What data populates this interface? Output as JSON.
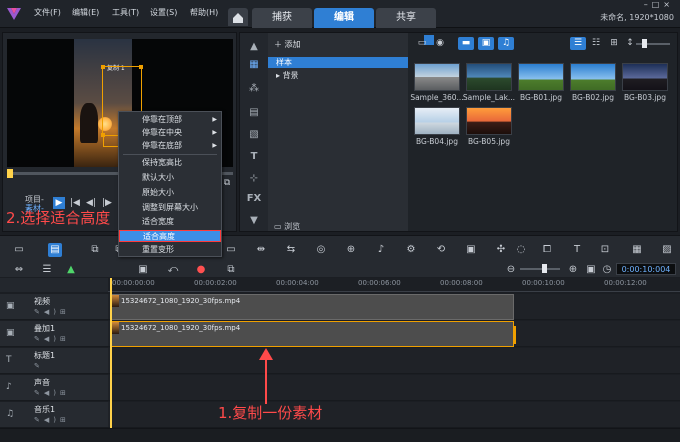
{
  "window": {
    "menu": [
      "文件(F)",
      "编辑(E)",
      "工具(T)",
      "设置(S)",
      "帮助(H)"
    ],
    "tabs": [
      "捕获",
      "编辑",
      "共享"
    ],
    "active_tab": "编辑",
    "project_info": "未命名, 1920*1080"
  },
  "player": {
    "project_label": "项目-",
    "clip_label": "素材-",
    "timecode_indicator": "V",
    "video_overlay_text": "复制 1"
  },
  "context_menu": {
    "items": [
      {
        "label": "停靠在顶部",
        "submenu": true
      },
      {
        "label": "停靠在中央",
        "submenu": true
      },
      {
        "label": "停靠在底部",
        "submenu": true
      },
      {
        "label": "保持宽高比",
        "submenu": false
      },
      {
        "label": "默认大小",
        "submenu": false
      },
      {
        "label": "原始大小",
        "submenu": false
      },
      {
        "label": "调整到屏幕大小",
        "submenu": false
      },
      {
        "label": "适合宽度",
        "submenu": false
      },
      {
        "label": "适合高度",
        "submenu": false,
        "highlighted": true
      },
      {
        "label": "重置变形",
        "submenu": false
      }
    ]
  },
  "library": {
    "add_label": "添加",
    "folders": [
      "样本",
      "背景"
    ],
    "selected_folder": "样本",
    "browse_label": "浏览",
    "thumbnails": [
      {
        "name": "Sample_360...",
        "style": "bg-sample1"
      },
      {
        "name": "Sample_Lak...",
        "style": "bg-sample2"
      },
      {
        "name": "BG-B01.jpg",
        "style": "bg-blue-sky"
      },
      {
        "name": "BG-B02.jpg",
        "style": "bg-blue-sky"
      },
      {
        "name": "BG-B03.jpg",
        "style": "bg-night"
      },
      {
        "name": "BG-B04.jpg",
        "style": "bg-b04"
      },
      {
        "name": "BG-B05.jpg",
        "style": "bg-sunset"
      }
    ]
  },
  "timeline": {
    "timecode": "0:00:10:004",
    "ruler_labels": [
      "00:00:00:00",
      "00:00:02:00",
      "00:00:04:00",
      "00:00:06:00",
      "00:00:08:00",
      "00:00:10:00",
      "00:00:12:00"
    ],
    "tracks": [
      {
        "name": "视频",
        "icon": "video-track-icon",
        "glyph": "▣"
      },
      {
        "name": "叠加1",
        "icon": "overlay-track-icon",
        "glyph": "▣"
      },
      {
        "name": "标题1",
        "icon": "title-track-icon",
        "glyph": "T"
      },
      {
        "name": "声音",
        "icon": "voice-track-icon",
        "glyph": "♪"
      },
      {
        "name": "音乐1",
        "icon": "music-track-icon",
        "glyph": "♫"
      }
    ],
    "clips": [
      {
        "track": 0,
        "name": "15324672_1080_1920_30fps.mp4",
        "selected": false
      },
      {
        "track": 1,
        "name": "15324672_1080_1920_30fps.mp4",
        "selected": true
      }
    ]
  },
  "annotations": {
    "step1": "1.复制一份素材",
    "step2": "2.选择适合高度",
    "color": "#ff4a4a"
  }
}
